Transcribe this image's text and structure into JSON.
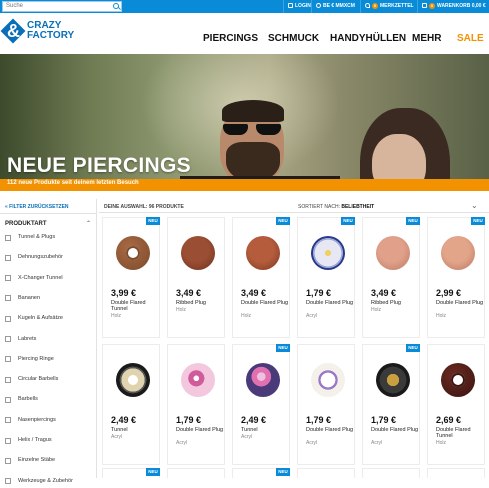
{
  "topbar": {
    "search_placeholder": "Suche",
    "login": "LOGIN",
    "shipping": "BE € MMXCM",
    "wishlist_count": "0",
    "wishlist": "MERKZETTEL",
    "cart_count": "0",
    "cart": "WARENKORB 0,00 €"
  },
  "logo": {
    "line1": "CRAZY",
    "line2": "FACTORY"
  },
  "nav": [
    "PIERCINGS",
    "SCHMUCK",
    "HANDYHÜLLEN",
    "MEHR",
    "SALE"
  ],
  "hero": {
    "title": "NEUE PIERCINGS"
  },
  "banner": "112 neue Produkte seit deinem letzten Besuch",
  "sidebar": {
    "reset": "« FILTER ZURÜCKSETZEN",
    "heading": "PRODUKTART",
    "caret": "⌃",
    "items": [
      "Tunnel & Plugs",
      "Dehnungszubehör",
      "X-Changer Tunnel",
      "Bananen",
      "Kugeln & Aufsätze",
      "Labrets",
      "Piercing Ringe",
      "Circular Barbells",
      "Barbells",
      "Nasenpiercings",
      "Helix / Tragus",
      "Einzelne Stäbe",
      "Werkzeuge & Zubehör"
    ]
  },
  "main": {
    "count": "DEINE AUSWAHL: 96 PRODUKTE",
    "sort_label": "SORTIERT NACH:",
    "sort_value": "BELIEBTHEIT",
    "chevron": "⌄",
    "new_badge": "NEU"
  },
  "products": [
    {
      "price": "3,99 €",
      "name": "Double Flared Tunnel",
      "material": "Holz",
      "new": true,
      "kind": "tunnel",
      "color": "#a86a44",
      "color2": "#7d4a2c"
    },
    {
      "price": "3,49 €",
      "name": "Ribbed Plug",
      "material": "Holz",
      "new": false,
      "kind": "plug",
      "color": "#9a4e33",
      "color2": "#6e3020"
    },
    {
      "price": "3,49 €",
      "name": "Double Flared Plug",
      "material": "Holz",
      "new": true,
      "kind": "plug",
      "color": "#b45c3c",
      "color2": "#7c3622"
    },
    {
      "price": "1,79 €",
      "name": "Double Flared Plug",
      "material": "Acryl",
      "new": true,
      "kind": "flower",
      "color": "#e8e8f4",
      "color2": "#2a3a8a"
    },
    {
      "price": "3,49 €",
      "name": "Ribbed Plug",
      "material": "Holz",
      "new": true,
      "kind": "plug",
      "color": "#e0a08a",
      "color2": "#b97a62"
    },
    {
      "price": "2,99 €",
      "name": "Double Flared Plug",
      "material": "Holz",
      "new": true,
      "kind": "plug",
      "color": "#e3a58a",
      "color2": "#b87660"
    },
    {
      "price": "2,49 €",
      "name": "Tunnel",
      "material": "Acryl",
      "new": false,
      "kind": "dial",
      "color": "#1a1a1a",
      "color2": "#e0d4b0"
    },
    {
      "price": "1,79 €",
      "name": "Double Flared Plug",
      "material": "Acryl",
      "new": false,
      "kind": "pink",
      "color": "#f3c8de",
      "color2": "#d05a9a"
    },
    {
      "price": "2,49 €",
      "name": "Tunnel",
      "material": "Acryl",
      "new": true,
      "kind": "wolf",
      "color": "#4a3a7a",
      "color2": "#e070b0"
    },
    {
      "price": "1,79 €",
      "name": "Double Flared Plug",
      "material": "Acryl",
      "new": false,
      "kind": "unicorn",
      "color": "#f4f0ea",
      "color2": "#9a7ac8"
    },
    {
      "price": "1,79 €",
      "name": "Double Flared Plug",
      "material": "Acryl",
      "new": true,
      "kind": "dark",
      "color": "#1a1a1a",
      "color2": "#c8a040"
    },
    {
      "price": "2,69 €",
      "name": "Double Flared Tunnel",
      "material": "Holz",
      "new": false,
      "kind": "tunnel",
      "color": "#6a2a22",
      "color2": "#3a1410"
    }
  ],
  "colors": {
    "accent_blue": "#0a8bd8",
    "accent_orange": "#f39200",
    "brand_blue": "#0a6fb7"
  }
}
